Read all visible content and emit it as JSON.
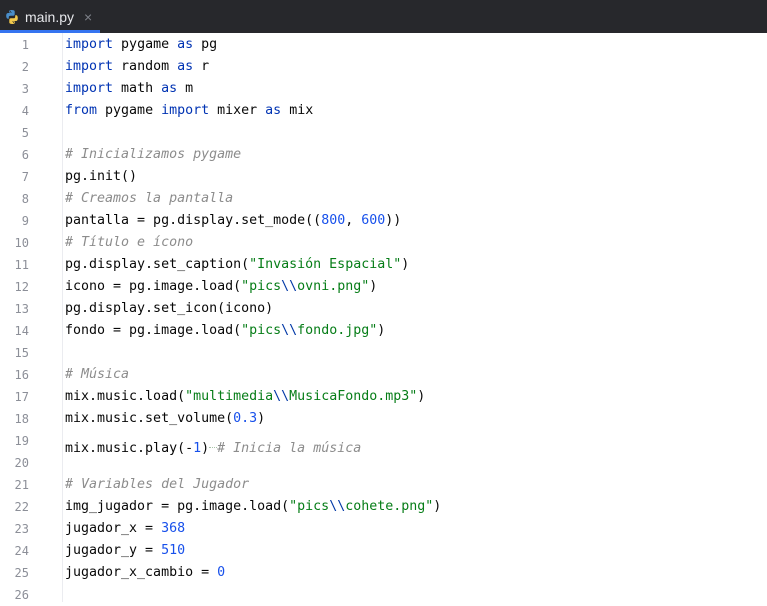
{
  "tab": {
    "label": "main.py",
    "close_glyph": "×",
    "icon": "python-file-icon"
  },
  "colors": {
    "keyword": "#0033b3",
    "number": "#1750eb",
    "string": "#067d17",
    "escape": "#0037a6",
    "comment": "#8c8c8c",
    "text": "#080808",
    "tab_accent": "#3574f0"
  },
  "lines": [
    {
      "n": "1",
      "tokens": [
        [
          "kw",
          "import"
        ],
        [
          "t",
          " pygame "
        ],
        [
          "kw",
          "as"
        ],
        [
          "t",
          " pg"
        ]
      ]
    },
    {
      "n": "2",
      "tokens": [
        [
          "kw",
          "import"
        ],
        [
          "t",
          " random "
        ],
        [
          "kw",
          "as"
        ],
        [
          "t",
          " r"
        ]
      ]
    },
    {
      "n": "3",
      "tokens": [
        [
          "kw",
          "import"
        ],
        [
          "t",
          " math "
        ],
        [
          "kw",
          "as"
        ],
        [
          "t",
          " m"
        ]
      ]
    },
    {
      "n": "4",
      "tokens": [
        [
          "kw",
          "from"
        ],
        [
          "t",
          " pygame "
        ],
        [
          "kw",
          "import"
        ],
        [
          "t",
          " mixer "
        ],
        [
          "kw",
          "as"
        ],
        [
          "t",
          " mix"
        ]
      ]
    },
    {
      "n": "5",
      "tokens": []
    },
    {
      "n": "6",
      "tokens": [
        [
          "cmt",
          "# Inicializamos pygame"
        ]
      ]
    },
    {
      "n": "7",
      "tokens": [
        [
          "t",
          "pg.init()"
        ]
      ]
    },
    {
      "n": "8",
      "tokens": [
        [
          "cmt",
          "# Creamos la pantalla"
        ]
      ]
    },
    {
      "n": "9",
      "tokens": [
        [
          "t",
          "pantalla = pg.display.set_mode(("
        ],
        [
          "num",
          "800"
        ],
        [
          "t",
          ", "
        ],
        [
          "num",
          "600"
        ],
        [
          "t",
          "))"
        ]
      ]
    },
    {
      "n": "10",
      "tokens": [
        [
          "cmt",
          "# Título e ícono"
        ]
      ]
    },
    {
      "n": "11",
      "tokens": [
        [
          "t",
          "pg.display.set_caption("
        ],
        [
          "str",
          "\"Invasión Espacial\""
        ],
        [
          "t",
          ")"
        ]
      ]
    },
    {
      "n": "12",
      "tokens": [
        [
          "t",
          "icono = pg.image.load("
        ],
        [
          "str",
          "\"pics"
        ],
        [
          "esc",
          "\\\\"
        ],
        [
          "str",
          "ovni.png\""
        ],
        [
          "t",
          ")"
        ]
      ]
    },
    {
      "n": "13",
      "tokens": [
        [
          "t",
          "pg.display.set_icon(icono)"
        ]
      ]
    },
    {
      "n": "14",
      "tokens": [
        [
          "t",
          "fondo = pg.image.load("
        ],
        [
          "str",
          "\"pics"
        ],
        [
          "esc",
          "\\\\"
        ],
        [
          "str",
          "fondo.jpg\""
        ],
        [
          "t",
          ")"
        ]
      ]
    },
    {
      "n": "15",
      "tokens": []
    },
    {
      "n": "16",
      "tokens": [
        [
          "cmt",
          "# Música"
        ]
      ]
    },
    {
      "n": "17",
      "tokens": [
        [
          "t",
          "mix.music.load("
        ],
        [
          "str",
          "\"multimedia"
        ],
        [
          "esc",
          "\\\\"
        ],
        [
          "str",
          "MusicaFondo.mp3\""
        ],
        [
          "t",
          ")"
        ]
      ]
    },
    {
      "n": "18",
      "tokens": [
        [
          "t",
          "mix.music.set_volume("
        ],
        [
          "num",
          "0.3"
        ],
        [
          "t",
          ")"
        ]
      ]
    },
    {
      "n": "19",
      "tokens": [
        [
          "t",
          "mix.music.play(-"
        ],
        [
          "num",
          "1"
        ],
        [
          "t",
          ")"
        ],
        [
          "sq",
          ""
        ],
        [
          "cmt",
          "# Inicia la música"
        ]
      ]
    },
    {
      "n": "20",
      "tokens": []
    },
    {
      "n": "21",
      "tokens": [
        [
          "cmt",
          "# Variables del Jugador"
        ]
      ]
    },
    {
      "n": "22",
      "tokens": [
        [
          "t",
          "img_jugador = pg.image.load("
        ],
        [
          "str",
          "\"pics"
        ],
        [
          "esc",
          "\\\\"
        ],
        [
          "str",
          "cohete.png\""
        ],
        [
          "t",
          ")"
        ]
      ]
    },
    {
      "n": "23",
      "tokens": [
        [
          "t",
          "jugador_x = "
        ],
        [
          "num",
          "368"
        ]
      ]
    },
    {
      "n": "24",
      "tokens": [
        [
          "t",
          "jugador_y = "
        ],
        [
          "num",
          "510"
        ]
      ]
    },
    {
      "n": "25",
      "tokens": [
        [
          "t",
          "jugador_x_cambio = "
        ],
        [
          "num",
          "0"
        ]
      ]
    },
    {
      "n": "26",
      "tokens": []
    }
  ]
}
